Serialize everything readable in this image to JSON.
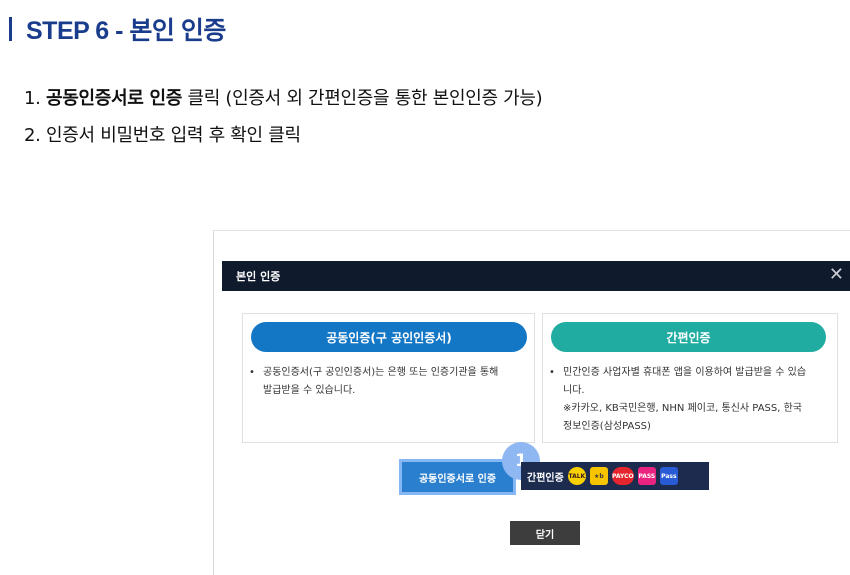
{
  "step_title": "STEP 6 - 본인 인증",
  "instructions": [
    {
      "num": "1.",
      "bold": "공동인증서로 인증",
      "rest": " 클릭 (인증서 외 간편인증을 통한 본인인증 가능)"
    },
    {
      "num": "2.",
      "bold": "",
      "rest": "인증서 비밀번호 입력 후 확인 클릭"
    }
  ],
  "modal": {
    "title": "본인 인증",
    "close_symbol": "✕",
    "left_panel": {
      "pill": "공동인증(구 공인인증서)",
      "bullet": "•",
      "desc_lines": [
        "공동인증서(구 공인인증서)는 은행 또는 인증기관을 통해",
        "발급받을 수 있습니다."
      ]
    },
    "right_panel": {
      "pill": "간편인증",
      "bullet": "•",
      "desc_lines": [
        "민간인증 사업자별 휴대폰 앱을 이용하여 발급받을 수 있습",
        "니다.",
        "※카카오, KB국민은행, NHN 페이코, 통신사 PASS, 한국",
        "정보인증(삼성PASS)"
      ]
    },
    "cert_button": "공동인증서로 인증",
    "badge": "1",
    "simple_button": "간편인증",
    "simple_icons": [
      {
        "name": "kakao-talk-icon",
        "label": "TALK",
        "bg": "#f9d000",
        "fg": "#3a1d1d",
        "w": 18,
        "round": true
      },
      {
        "name": "kb-star-icon",
        "label": "★b",
        "bg": "#f7c400",
        "fg": "#3a3a3a",
        "w": 18,
        "round": false
      },
      {
        "name": "payco-icon",
        "label": "PAYCO",
        "bg": "#e5252d",
        "fg": "#ffffff",
        "w": 22,
        "round": true
      },
      {
        "name": "pass-icon",
        "label": "PASS",
        "bg": "#e9237f",
        "fg": "#ffffff",
        "w": 18,
        "round": false
      },
      {
        "name": "samsung-pass-icon",
        "label": "Pass",
        "bg": "#2a5bd7",
        "fg": "#ffffff",
        "w": 18,
        "round": false
      }
    ],
    "close_button": "닫기"
  }
}
